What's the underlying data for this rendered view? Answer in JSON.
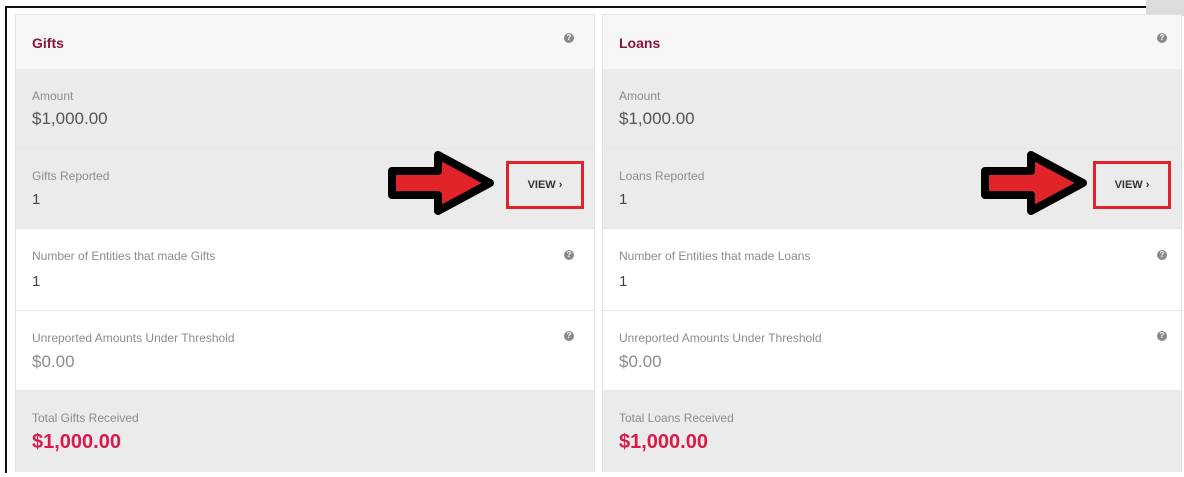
{
  "panels": [
    {
      "title": "Gifts",
      "amount_label": "Amount",
      "amount_value": "$1,000.00",
      "reported_label": "Gifts Reported",
      "reported_value": "1",
      "view_label": "VIEW ›",
      "entities_label": "Number of Entities that made Gifts",
      "entities_value": "1",
      "unreported_label": "Unreported Amounts Under Threshold",
      "unreported_value": "$0.00",
      "total_label": "Total Gifts Received",
      "total_value": "$1,000.00"
    },
    {
      "title": "Loans",
      "amount_label": "Amount",
      "amount_value": "$1,000.00",
      "reported_label": "Loans Reported",
      "reported_value": "1",
      "view_label": "VIEW ›",
      "entities_label": "Number of Entities that made Loans",
      "entities_value": "1",
      "unreported_label": "Unreported Amounts Under Threshold",
      "unreported_value": "$0.00",
      "total_label": "Total Loans Received",
      "total_value": "$1,000.00"
    }
  ],
  "icons": {
    "help": "?"
  },
  "colors": {
    "title": "#8a1538",
    "total": "#d81b4a",
    "highlight_box": "#e0242a",
    "arrow_fill": "#e0242a",
    "arrow_outline": "#000000"
  }
}
